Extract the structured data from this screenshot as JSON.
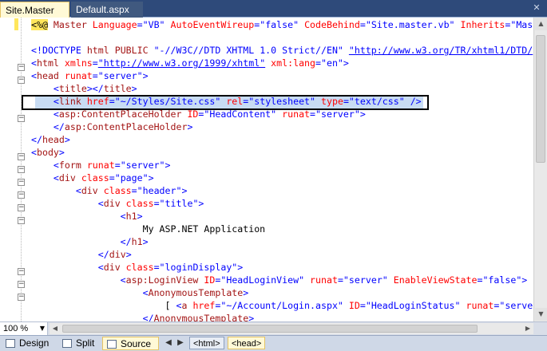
{
  "tabs": [
    {
      "label": "Site.Master",
      "active": true
    },
    {
      "label": "Default.aspx",
      "active": false
    }
  ],
  "icons": {
    "close": "close-icon",
    "up": "scroll-up-icon",
    "down": "scroll-down-icon"
  },
  "editor": {
    "lines": [
      [
        [
          "hl",
          "<%@"
        ],
        [
          "m",
          " Master "
        ],
        [
          "r",
          "Language"
        ],
        [
          "b",
          "=\"VB\" "
        ],
        [
          "r",
          "AutoEventWireup"
        ],
        [
          "b",
          "=\"false\" "
        ],
        [
          "r",
          "CodeBehind"
        ],
        [
          "b",
          "=\"Site.master.vb\" "
        ],
        [
          "r",
          "Inherits"
        ],
        [
          "b",
          "=\"Mas"
        ]
      ],
      [],
      [
        [
          "b",
          "<!DOCTYPE "
        ],
        [
          "m",
          "html PUBLIC "
        ],
        [
          "b",
          "\"-//W3C//DTD XHTML 1.0 Strict//EN\" "
        ],
        [
          "u",
          "\"http://www.w3.org/TR/xhtml1/DTD/"
        ]
      ],
      [
        [
          "b",
          "<"
        ],
        [
          "m",
          "html "
        ],
        [
          "r",
          "xmlns"
        ],
        [
          "b",
          "="
        ],
        [
          "u",
          "\"http://www.w3.org/1999/xhtml\""
        ],
        [
          "b",
          " "
        ],
        [
          "r",
          "xml:lang"
        ],
        [
          "b",
          "=\"en\">"
        ]
      ],
      [
        [
          "b",
          "<"
        ],
        [
          "m",
          "head "
        ],
        [
          "r",
          "runat"
        ],
        [
          "b",
          "=\"server\">"
        ]
      ],
      [
        [
          "b",
          "    <"
        ],
        [
          "m",
          "title"
        ],
        [
          "b",
          "></"
        ],
        [
          "m",
          "title"
        ],
        [
          "b",
          ">"
        ]
      ],
      [
        [
          "b",
          "    <"
        ],
        [
          "m",
          "link "
        ],
        [
          "r",
          "href"
        ],
        [
          "b",
          "=\"~/Styles/Site.css\" "
        ],
        [
          "r",
          "rel"
        ],
        [
          "b",
          "=\"stylesheet\" "
        ],
        [
          "r",
          "type"
        ],
        [
          "b",
          "=\"text/css\" />"
        ]
      ],
      [
        [
          "b",
          "    <"
        ],
        [
          "m",
          "asp:ContentPlaceHolder "
        ],
        [
          "r",
          "ID"
        ],
        [
          "b",
          "=\"HeadContent\" "
        ],
        [
          "r",
          "runat"
        ],
        [
          "b",
          "=\"server\">"
        ]
      ],
      [
        [
          "b",
          "    </"
        ],
        [
          "m",
          "asp:ContentPlaceHolder"
        ],
        [
          "b",
          ">"
        ]
      ],
      [
        [
          "b",
          "</"
        ],
        [
          "m",
          "head"
        ],
        [
          "b",
          ">"
        ]
      ],
      [
        [
          "b",
          "<"
        ],
        [
          "m",
          "body"
        ],
        [
          "b",
          ">"
        ]
      ],
      [
        [
          "b",
          "    <"
        ],
        [
          "m",
          "form "
        ],
        [
          "r",
          "runat"
        ],
        [
          "b",
          "=\"server\">"
        ]
      ],
      [
        [
          "b",
          "    <"
        ],
        [
          "m",
          "div "
        ],
        [
          "r",
          "class"
        ],
        [
          "b",
          "=\"page\">"
        ]
      ],
      [
        [
          "b",
          "        <"
        ],
        [
          "m",
          "div "
        ],
        [
          "r",
          "class"
        ],
        [
          "b",
          "=\"header\">"
        ]
      ],
      [
        [
          "b",
          "            <"
        ],
        [
          "m",
          "div "
        ],
        [
          "r",
          "class"
        ],
        [
          "b",
          "=\"title\">"
        ]
      ],
      [
        [
          "b",
          "                <"
        ],
        [
          "m",
          "h1"
        ],
        [
          "b",
          ">"
        ]
      ],
      [
        [
          "t",
          "                    My ASP.NET Application"
        ]
      ],
      [
        [
          "b",
          "                </"
        ],
        [
          "m",
          "h1"
        ],
        [
          "b",
          ">"
        ]
      ],
      [
        [
          "b",
          "            </"
        ],
        [
          "m",
          "div"
        ],
        [
          "b",
          ">"
        ]
      ],
      [
        [
          "b",
          "            <"
        ],
        [
          "m",
          "div "
        ],
        [
          "r",
          "class"
        ],
        [
          "b",
          "=\"loginDisplay\">"
        ]
      ],
      [
        [
          "b",
          "                <"
        ],
        [
          "m",
          "asp:LoginView "
        ],
        [
          "r",
          "ID"
        ],
        [
          "b",
          "=\"HeadLoginView\" "
        ],
        [
          "r",
          "runat"
        ],
        [
          "b",
          "=\"server\" "
        ],
        [
          "r",
          "EnableViewState"
        ],
        [
          "b",
          "=\"false\">"
        ]
      ],
      [
        [
          "b",
          "                    <"
        ],
        [
          "m",
          "AnonymousTemplate"
        ],
        [
          "b",
          ">"
        ]
      ],
      [
        [
          "t",
          "                        [ "
        ],
        [
          "b",
          "<"
        ],
        [
          "m",
          "a "
        ],
        [
          "r",
          "href"
        ],
        [
          "b",
          "=\"~/Account/Login.aspx\" "
        ],
        [
          "r",
          "ID"
        ],
        [
          "b",
          "=\"HeadLoginStatus\" "
        ],
        [
          "r",
          "runat"
        ],
        [
          "b",
          "=\"serve"
        ]
      ],
      [
        [
          "b",
          "                    </"
        ],
        [
          "m",
          "AnonymousTemplate"
        ],
        [
          "b",
          ">"
        ]
      ]
    ]
  },
  "zoom": {
    "value": "100 %"
  },
  "views": [
    {
      "label": "Design",
      "active": false
    },
    {
      "label": "Split",
      "active": false
    },
    {
      "label": "Source",
      "active": true
    }
  ],
  "breadcrumbs": [
    "<html>",
    "<head>"
  ]
}
